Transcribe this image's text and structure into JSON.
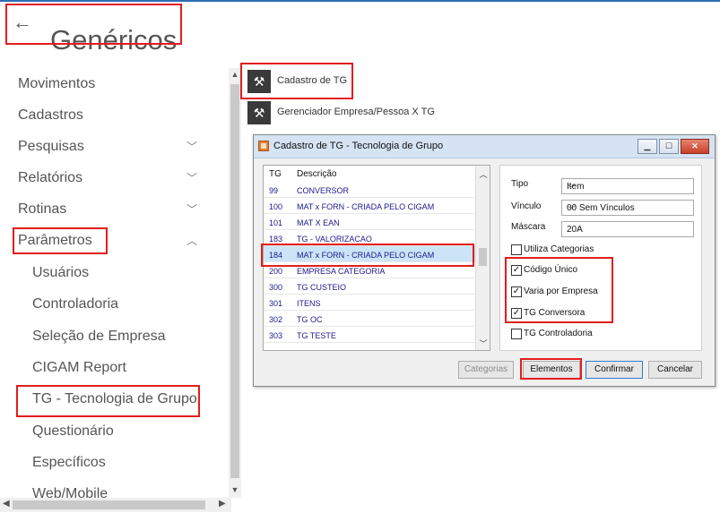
{
  "header": {
    "back_glyph": "←",
    "title": "Genéricos"
  },
  "sidebar": {
    "items": [
      {
        "label": "Movimentos",
        "chevron": ""
      },
      {
        "label": "Cadastros",
        "chevron": ""
      },
      {
        "label": "Pesquisas",
        "chevron": "﹀"
      },
      {
        "label": "Relatórios",
        "chevron": "﹀"
      },
      {
        "label": "Rotinas",
        "chevron": "﹀"
      },
      {
        "label": "Parâmetros",
        "chevron": "︿"
      }
    ],
    "subitems": [
      {
        "label": "Usuários"
      },
      {
        "label": "Controladoria"
      },
      {
        "label": "Seleção de Empresa"
      },
      {
        "label": "CIGAM Report"
      },
      {
        "label": "TG - Tecnologia de Grupo"
      },
      {
        "label": "Questionário"
      },
      {
        "label": "Específicos"
      },
      {
        "label": "Web/Mobile"
      }
    ]
  },
  "tools": [
    {
      "label": "Cadastro de TG",
      "icon": "wrench-icon"
    },
    {
      "label": "Gerenciador Empresa/Pessoa X TG",
      "icon": "wrench-icon"
    }
  ],
  "dialog": {
    "title": "Cadastro de TG - Tecnologia de Grupo",
    "window_buttons": {
      "minimize": "▁",
      "maximize": "☐",
      "close": "✕"
    },
    "grid": {
      "columns": [
        "TG",
        "Descrição"
      ],
      "rows": [
        {
          "tg": "99",
          "desc": "CONVERSOR"
        },
        {
          "tg": "100",
          "desc": "MAT x FORN - CRIADA PELO CIGAM"
        },
        {
          "tg": "101",
          "desc": "MAT X EAN"
        },
        {
          "tg": "183",
          "desc": "TG - VALORIZACAO"
        },
        {
          "tg": "184",
          "desc": "MAT x FORN - CRIADA PELO CIGAM"
        },
        {
          "tg": "200",
          "desc": "EMPRESA CATEGORIA"
        },
        {
          "tg": "300",
          "desc": "TG CUSTEIO"
        },
        {
          "tg": "301",
          "desc": "ITENS"
        },
        {
          "tg": "302",
          "desc": "TG OC"
        },
        {
          "tg": "303",
          "desc": "TG TESTE"
        }
      ],
      "selected_index": 4
    },
    "form": {
      "tipo_label": "Tipo",
      "tipo_value": "Item",
      "vinculo_label": "Vínculo",
      "vinculo_value": "00 Sem Vínculos",
      "mascara_label": "Máscara",
      "mascara_value": "20A",
      "checks": [
        {
          "label": "Utiliza Categorias",
          "checked": false
        },
        {
          "label": "Código Único",
          "checked": true
        },
        {
          "label": "Varia por Empresa",
          "checked": true
        },
        {
          "label": "TG Conversora",
          "checked": true
        },
        {
          "label": "TG Controladoria",
          "checked": false
        }
      ]
    },
    "buttons": {
      "categorias": "Categorias",
      "elementos": "Elementos",
      "confirmar": "Confirmar",
      "cancelar": "Cancelar"
    }
  },
  "colors": {
    "highlight_border": "#e21d1d",
    "selected_row": "#cce4f7",
    "grid_text": "#1a1a8a"
  }
}
